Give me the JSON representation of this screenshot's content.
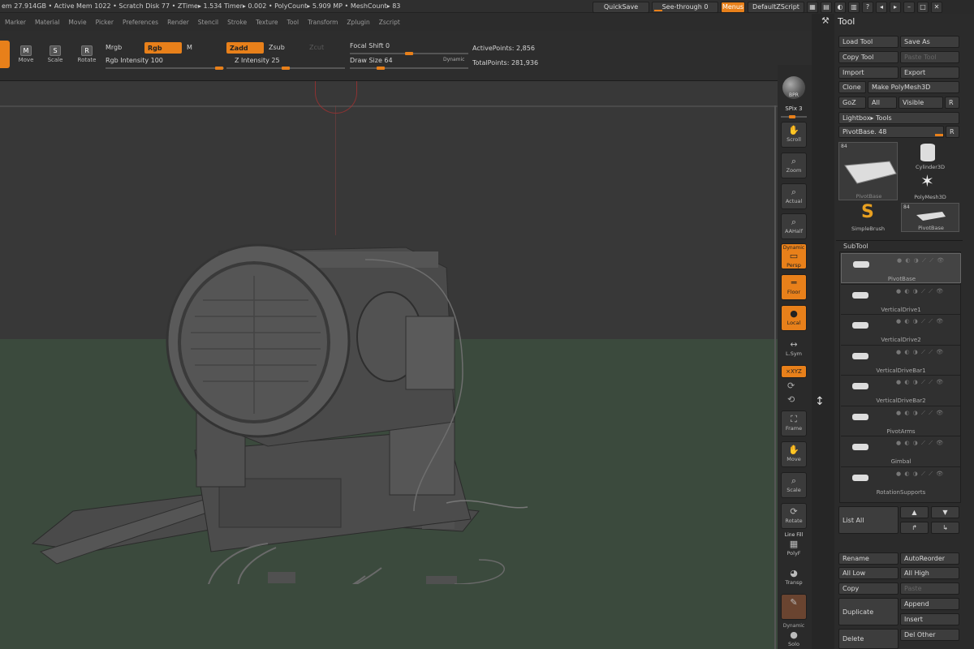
{
  "statusbar": {
    "text1": "em 27.914GB",
    "text2": "Active Mem 1022",
    "text3": "Scratch Disk 77",
    "text4": "ZTime▸ 1.534 Timer▸ 0.002",
    "text5": "PolyCount▸ 5.909 MP",
    "text6": "MeshCount▸ 83"
  },
  "topright": {
    "quicksave": "QuickSave",
    "seethrough": "See-through  0",
    "menus": "Menus",
    "defaultzscript": "DefaultZScript"
  },
  "menubar": [
    "Marker",
    "Material",
    "Movie",
    "Picker",
    "Preferences",
    "Render",
    "Stencil",
    "Stroke",
    "Texture",
    "Tool",
    "Transform",
    "Zplugin",
    "Zscript"
  ],
  "toolbar": {
    "move": "Move",
    "scale": "Scale",
    "rotate": "Rotate",
    "mrgb": "Mrgb",
    "rgb": "Rgb",
    "m": "M",
    "rgb_intensity": "Rgb  Intensity 100",
    "zadd": "Zadd",
    "zsub": "Zsub",
    "zcut": "Zcut",
    "z_intensity": "Z Intensity 25",
    "focal_shift": "Focal Shift 0",
    "draw_size": "Draw Size 64",
    "dynamic": "Dynamic",
    "active_points": "ActivePoints: 2,856",
    "total_points": "TotalPoints: 281,936"
  },
  "dock": {
    "bpr": "BPR",
    "spix": "SPix 3",
    "scroll": "Scroll",
    "zoom": "Zoom",
    "actual": "Actual",
    "aahalf": "AAHalf",
    "dynamic": "Dynamic",
    "persp": "Persp",
    "floor": "Floor",
    "local": "Local",
    "lsym": "L.Sym",
    "xyz": "×XYZ",
    "frame": "Frame",
    "move": "Move",
    "scale": "Scale",
    "rotate": "Rotate",
    "linefill": "Line Fill",
    "polyf": "PolyF",
    "transp": "Transp",
    "dynamic2": "Dynamic",
    "solo": "Solo"
  },
  "toolpanel": {
    "title": "Tool",
    "load_tool": "Load Tool",
    "save_as": "Save As",
    "copy_tool": "Copy Tool",
    "paste_tool": "Paste Tool",
    "import": "Import",
    "export": "Export",
    "clone": "Clone",
    "make_polymesh": "Make PolyMesh3D",
    "goz": "GoZ",
    "all": "All",
    "visible": "Visible",
    "r": "R",
    "lightbox_tools": "Lightbox▸ Tools",
    "pivotbase": "PivotBase. 48",
    "r2": "R",
    "thumb_count1": "84",
    "thumb_pivotbase": "PivotBase",
    "cylinder": "Cylinder3D",
    "polymesh": "PolyMesh3D",
    "simplebrush": "SimpleBrush",
    "thumb_count2": "84",
    "thumb_pivotbase2": "PivotBase",
    "subtool": "SubTool",
    "subtools": [
      "PivotBase",
      "VerticalDrive1",
      "VerticalDrive2",
      "VerticalDriveBar1",
      "VerticalDriveBar2",
      "PivotArms",
      "Gimbal",
      "RotationSupports"
    ],
    "list_all": "List  All",
    "rename": "Rename",
    "autoreorder": "AutoReorder",
    "all_low": "All Low",
    "all_high": "All High",
    "copy": "Copy",
    "paste": "Paste",
    "duplicate": "Duplicate",
    "append": "Append",
    "insert": "Insert",
    "delete": "Delete",
    "del_other": "Del Other"
  },
  "colors": {
    "accent": "#e8801a",
    "background": "#383838",
    "floor": "#3b4a3d",
    "panel": "#2b2b2b"
  }
}
